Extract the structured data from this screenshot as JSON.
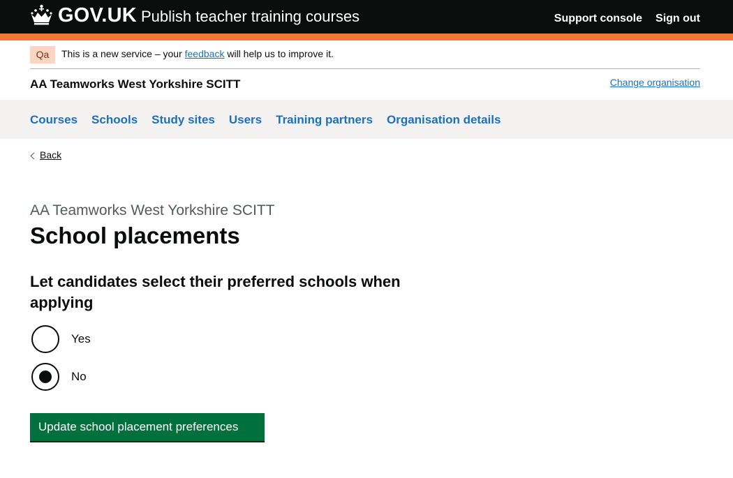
{
  "header": {
    "logo_text": "GOV.UK",
    "service_name": "Publish teacher training courses",
    "nav": [
      "Support console",
      "Sign out"
    ]
  },
  "phase_banner": {
    "tag": "Qa",
    "text_before": "This is a new service – your ",
    "link": "feedback",
    "text_after": " will help us to improve it."
  },
  "organisation": {
    "name": "AA Teamworks West Yorkshire SCITT",
    "change_link": "Change organisation"
  },
  "primary_nav": [
    "Courses",
    "Schools",
    "Study sites",
    "Users",
    "Training partners",
    "Organisation details"
  ],
  "back_link": "Back",
  "page": {
    "caption": "AA Teamworks West Yorkshire SCITT",
    "title": "School placements",
    "question": "Let candidates select their preferred schools when applying",
    "options": [
      {
        "label": "Yes",
        "selected": false
      },
      {
        "label": "No",
        "selected": true
      }
    ],
    "submit_label": "Update school placement preferences"
  },
  "colors": {
    "header_bg": "#0b0c0c",
    "stripe": "#f47738",
    "link": "#1d70b8",
    "button": "#00703c"
  }
}
